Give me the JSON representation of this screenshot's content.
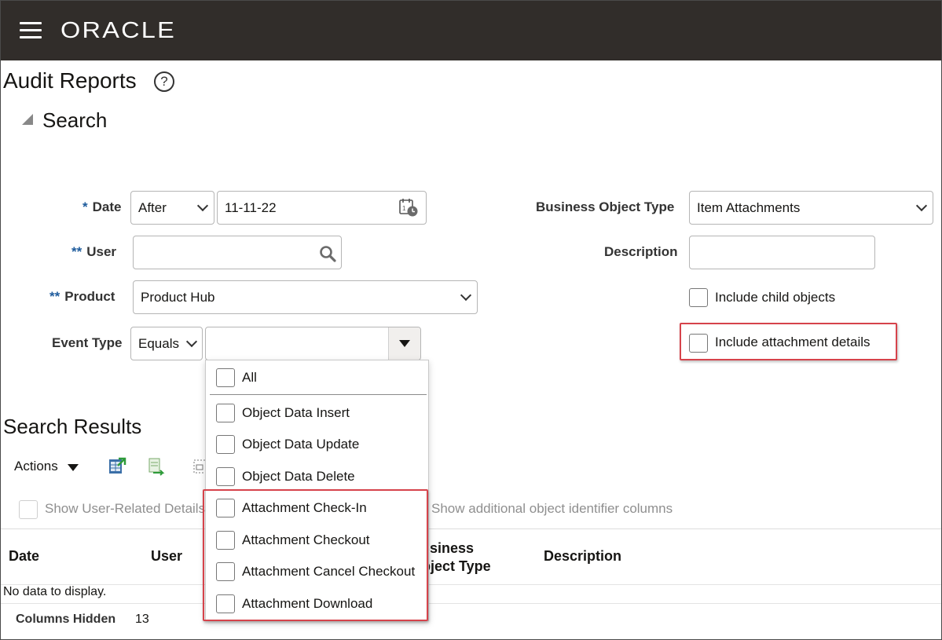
{
  "header": {
    "brand": "ORACLE"
  },
  "page": {
    "title": "Audit Reports",
    "help_glyph": "?"
  },
  "search": {
    "heading": "Search",
    "date": {
      "required_mark": "*",
      "label": "Date",
      "operator": "After",
      "value": "11-11-22"
    },
    "user": {
      "required_mark": "**",
      "label": "User",
      "value": ""
    },
    "product": {
      "required_mark": "**",
      "label": "Product",
      "value": "Product Hub"
    },
    "event_type": {
      "label": "Event Type",
      "operator": "Equals",
      "value": ""
    },
    "business_object_type": {
      "label": "Business Object Type",
      "value": "Item Attachments"
    },
    "description": {
      "label": "Description",
      "value": ""
    },
    "include_child_objects": {
      "label": "Include child objects",
      "checked": false
    },
    "include_attachment_details": {
      "label": "Include attachment details",
      "checked": false
    }
  },
  "event_type_dropdown": {
    "all_label": "All",
    "options": [
      "Object Data Insert",
      "Object Data Update",
      "Object Data Delete",
      "Attachment Check-In",
      "Attachment Checkout",
      "Attachment Cancel Checkout",
      "Attachment Download"
    ]
  },
  "results": {
    "title": "Search Results",
    "actions_label": "Actions",
    "show_user_related_label": "Show User-Related Details",
    "show_additional_label": "Show additional object identifier columns",
    "columns": [
      "Date",
      "User",
      "Business Object Type",
      "Description"
    ],
    "col_business_line1": "Business",
    "col_business_line2": "Object Type",
    "empty_text": "No data to display.",
    "columns_hidden_label": "Columns Hidden",
    "columns_hidden_value": "13"
  },
  "colors": {
    "header_bg": "#312d2a",
    "required_mark": "#1d5b9c",
    "highlight_border": "#d6434b"
  }
}
